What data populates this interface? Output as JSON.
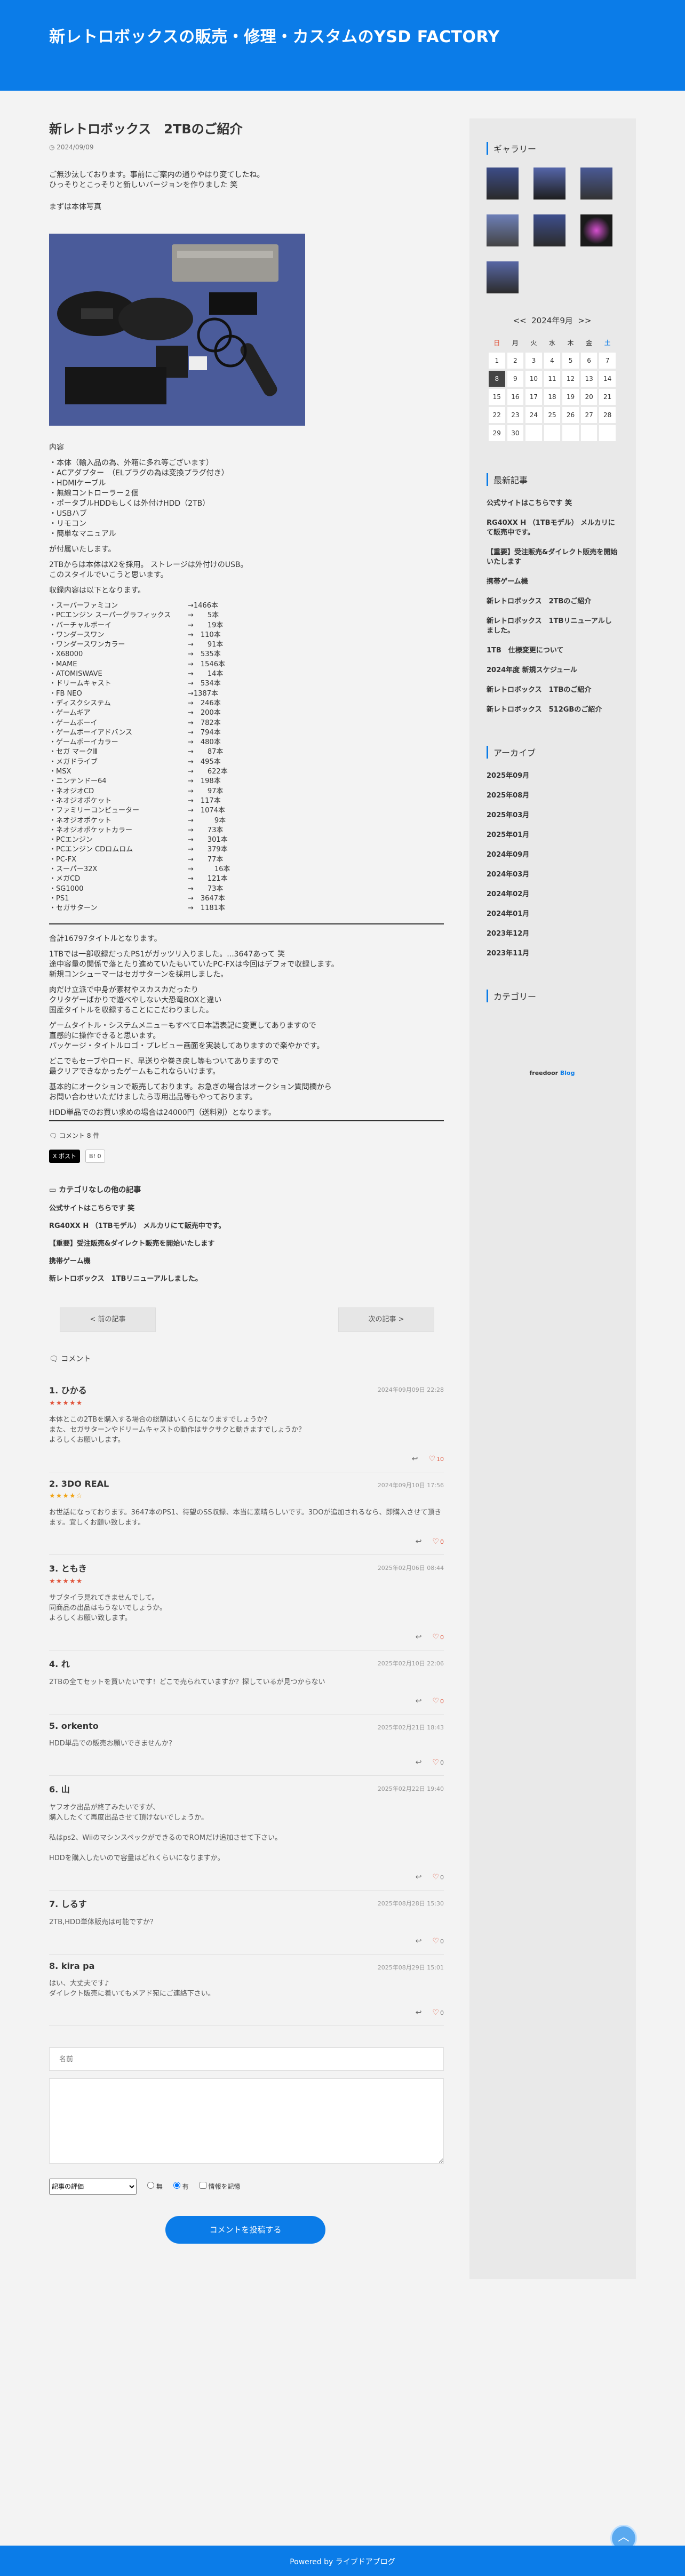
{
  "header": {
    "site_title": "新レトロボックスの販売・修理・カスタムのYSD FACTORY"
  },
  "article": {
    "title": "新レトロボックス　2TBのご紹介",
    "date": "2024/09/09",
    "intro": [
      "ご無沙汰しております。事前にご案内の通りやはり変てしたね。",
      "ひっそりとこっそりと新しいバージョンを作りました 笑"
    ],
    "photo_caption": "まずは本体写真",
    "contents_head": "内容",
    "contents": [
      "・本体（輸入品の為、外箱に多れ等ございます）",
      "・ACアダプター　（ELプラグの為は変換プラグ付き）",
      "・HDMIケーブル",
      "・無線コントローラー２個",
      "・ポータブルHDDもしくは外付けHDD（2TB）",
      "・USBハブ",
      "・リモコン",
      "・簡単なマニュアル"
    ],
    "p1": "が付属いたします。",
    "p2": [
      "2TBからは本体はX2を採用。 ストレージは外付けのUSB。",
      "このスタイルでいこうと思います。"
    ],
    "p3": "収録内容は以下となります。",
    "systems": [
      [
        "・スーパーファミコン",
        "→1466本"
      ],
      [
        "・PCエンジン スーパーグラフィックス",
        "→　　5本"
      ],
      [
        "・バーチャルボーイ",
        "→　　19本"
      ],
      [
        "・ワンダースワン",
        "→　110本"
      ],
      [
        "・ワンダースワンカラー",
        "→　　91本"
      ],
      [
        "・X68000",
        "→　535本"
      ],
      [
        "・MAME",
        "→　1546本"
      ],
      [
        "・ATOMISWAVE",
        "→　　14本"
      ],
      [
        "・ドリームキャスト",
        "→　534本"
      ],
      [
        "・FB NEO",
        "→1387本"
      ],
      [
        "・ディスクシステム",
        "→　246本"
      ],
      [
        "・ゲームギア",
        "→　200本"
      ],
      [
        "・ゲームボーイ",
        "→　782本"
      ],
      [
        "・ゲームボーイアドバンス",
        "→　794本"
      ],
      [
        "・ゲームボーイカラー",
        "→　480本"
      ],
      [
        "・セガ マークⅢ",
        "→　　87本"
      ],
      [
        "・メガドライブ",
        "→　495本"
      ],
      [
        "・MSX",
        "→　　622本"
      ],
      [
        "・ニンテンドー64",
        "→　198本"
      ],
      [
        "・ネオジオCD",
        "→　　97本"
      ],
      [
        "・ネオジオポケット",
        "→　117本"
      ],
      [
        "・ファミリーコンピューター",
        "→　1074本"
      ],
      [
        "・ネオジオポケット",
        "→　　　9本"
      ],
      [
        "・ネオジオポケットカラー",
        "→　　73本"
      ],
      [
        "・PCエンジン",
        "→　　301本"
      ],
      [
        "・PCエンジン CDロムロム",
        "→　　379本"
      ],
      [
        "・PC-FX",
        "→　　77本"
      ],
      [
        "・スーパー32X",
        "→　　　16本"
      ],
      [
        "・メガCD",
        "→　　121本"
      ],
      [
        "・SG1000",
        "→　　73本"
      ],
      [
        "・PS1",
        "→　3647本"
      ],
      [
        "・セガサターン",
        "→　1181本"
      ]
    ],
    "total": "合計16797タイトルとなります。",
    "p4": [
      "1TBでは一部収録だったPS1がガッツリ入りました。...3647あって 笑",
      "途中容量の関係で落とたり進めていたもいていたPC-FXは今回はデフォで収録します。",
      "新規コンシューマーはセガサターンを採用しました。"
    ],
    "p5": [
      "肉だけ立派で中身が素材やスカスカだったり",
      "クリタゲーばかりで遊べやしない大恐竜BOXと違い",
      "国産タイトルを収録することにこだわりました。"
    ],
    "p6": [
      "ゲームタイトル・システムメニューもすべて日本語表記に変更してありますので",
      "直感的に操作できると思います。",
      "パッケージ・タイトルロゴ・プレビュー画面を実装してありますので楽やかです。"
    ],
    "p7": [
      "どこでもセーブやロード、早送りや巻き戻し等もついてありますので",
      "最クリアできなかったゲームもこれならいけます。"
    ],
    "p8": [
      "基本的にオークションで販売しております。お急ぎの場合はオークション質問欄から",
      "お問い合わせいただけましたら専用出品等もやっております。"
    ],
    "p9": "HDD単品でのお買い求めの場合は24000円（送料別）となります。",
    "comment_meta": "コメント",
    "comment_meta_count": "8 件",
    "share_x": "X ポスト",
    "share_hatena": "B! 0",
    "related_head": "カテゴリなしの他の記事",
    "related": [
      "公式サイトはこちらです 笑",
      "RG40XX H （1TBモデル） メルカリにて販売中です。",
      "【重要】受注販売&ダイレクト販売を開始いたします",
      "携帯ゲーム機",
      "新レトロボックス　1TBリニューアルしました。"
    ],
    "prev": "< 前の記事",
    "next": "次の記事 >"
  },
  "comments": {
    "heading": "コメント",
    "items": [
      {
        "num": "1.",
        "name": "ひかる",
        "date": "2024年09月09日 22:28",
        "stars": "★★★★★",
        "star_color": "red",
        "text": [
          "本体とこの2TBを購入する場合の総額はいくらになりますでしょうか？",
          "また、セガサターンやドリームキャストの動作はサクサクと動きますでしょうか？",
          "よろしくお願いします。"
        ],
        "likes": "10"
      },
      {
        "num": "2.",
        "name": "3DO REAL",
        "date": "2024年09月10日 17:56",
        "stars": "★★★★☆",
        "star_color": "yellow",
        "text": [
          "お世話になっております。3647本のPS1、待望のSS収録、本当に素晴らしいです。3DOが追加されるなら、即購入させて頂きます。宜しくお願い致します。"
        ],
        "likes": "0"
      },
      {
        "num": "3.",
        "name": "ともき",
        "date": "2025年02月06日 08:44",
        "stars": "★★★★★",
        "star_color": "red",
        "text": [
          "サブタイラ見れてきませんでして。",
          "同商品の出品はもうないでしょうか。",
          "よろしくお願い致します。"
        ],
        "likes": "0"
      },
      {
        "num": "4.",
        "name": "れ",
        "date": "2025年02月10日 22:06",
        "stars": "",
        "star_color": "",
        "text": [
          "2TBの全てセットを買いたいです！どこで売られていますか？探しているが見つからない"
        ],
        "likes": "0"
      },
      {
        "num": "5.",
        "name": "orkento",
        "date": "2025年02月21日 18:43",
        "stars": "",
        "star_color": "",
        "text": [
          "HDD単品での販売お願いできませんか？"
        ],
        "likes": "0"
      },
      {
        "num": "6.",
        "name": "山",
        "date": "2025年02月22日 19:40",
        "stars": "",
        "star_color": "",
        "text": [
          "ヤフオク出品が終了みたいですが、",
          "購入したくて再度出品させて頂けないでしょうか。",
          "",
          "私はps2、WiiのマシンスペックができるのでROMだけ追加させて下さい。",
          "",
          "HDDを購入したいので容量はどれくらいになりますか。"
        ],
        "likes": "0"
      },
      {
        "num": "7.",
        "name": "しるす",
        "date": "2025年08月28日 15:30",
        "stars": "",
        "star_color": "",
        "text": [
          "2TB,HDD単体販売は可能ですか？"
        ],
        "likes": "0"
      },
      {
        "num": "8.",
        "name": "kira pa",
        "date": "2025年08月29日 15:01",
        "stars": "",
        "star_color": "",
        "text": [
          "はい、大丈夫です♪",
          "ダイレクト販売に着いてもメアド宛にご連絡下さい。"
        ],
        "likes": "0"
      }
    ]
  },
  "form": {
    "name_placeholder": "名前",
    "select_value": "記事の評価",
    "radio_no": "無",
    "radio_yes": "有",
    "remember": "情報を記憶",
    "submit": "コメントを投稿する"
  },
  "sidebar": {
    "gallery_head": "ギャラリー",
    "calendar": {
      "prev": "<<",
      "month": "2024年9月",
      "next": ">>",
      "weekdays": [
        "日",
        "月",
        "火",
        "水",
        "木",
        "金",
        "土"
      ],
      "weeks": [
        [
          "1",
          "2",
          "3",
          "4",
          "5",
          "6",
          "7"
        ],
        [
          "8",
          "9",
          "10",
          "11",
          "12",
          "13",
          "14"
        ],
        [
          "15",
          "16",
          "17",
          "18",
          "19",
          "20",
          "21"
        ],
        [
          "22",
          "23",
          "24",
          "25",
          "26",
          "27",
          "28"
        ],
        [
          "29",
          "30",
          "",
          "",
          "",
          "",
          ""
        ]
      ]
    },
    "recent_head": "最新記事",
    "recent": [
      "公式サイトはこちらです 笑",
      "RG40XX H （1TBモデル） メルカリにて販売中です。",
      "【重要】受注販売&ダイレクト販売を開始いたします",
      "携帯ゲーム機",
      "新レトロボックス　2TBのご紹介",
      "新レトロボックス　1TBリニューアルしました。",
      "1TB　仕様変更について",
      "2024年度 新規スケジュール",
      "新レトロボックス　1TBのご紹介",
      "新レトロボックス　512GBのご紹介"
    ],
    "archive_head": "アーカイブ",
    "archive": [
      "2025年09月",
      "2025年08月",
      "2025年03月",
      "2025年01月",
      "2024年09月",
      "2024年03月",
      "2024年02月",
      "2024年01月",
      "2023年12月",
      "2023年11月"
    ],
    "category_head": "カテゴリー",
    "freedoor": "freedoor",
    "blog": "Blog"
  },
  "footer": {
    "powered": "Powered by ライブドアブログ"
  },
  "colors": {
    "brand": "#0b7ce8"
  }
}
